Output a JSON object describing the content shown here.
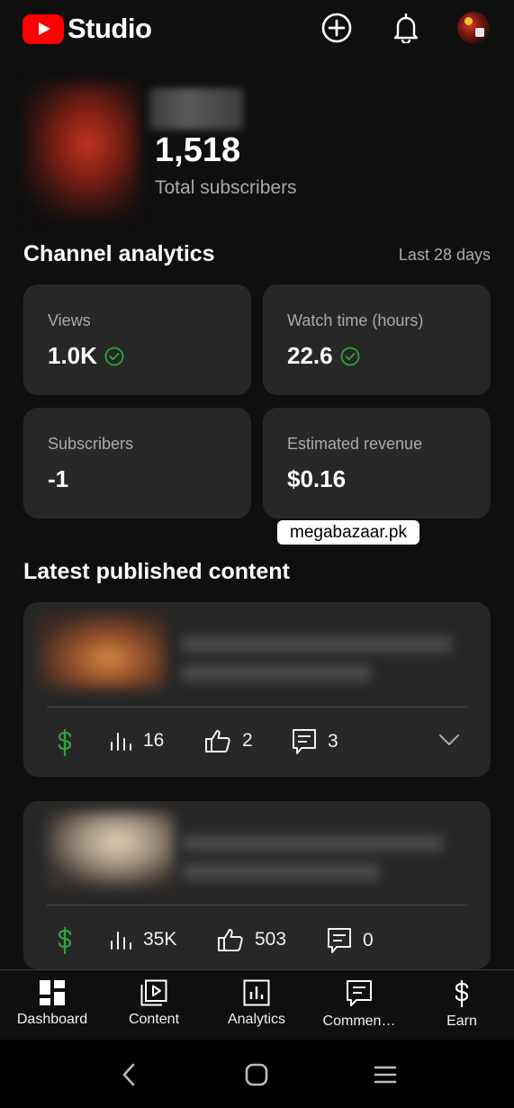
{
  "app": {
    "logo_text": "Studio",
    "logo_color": "#ff0000"
  },
  "header": {
    "icons": [
      "create-icon",
      "notifications-icon"
    ],
    "subscriber_count": "1,518",
    "subscriber_label": "Total subscribers"
  },
  "analytics": {
    "title": "Channel analytics",
    "range": "Last 28 days",
    "cards": [
      {
        "label": "Views",
        "value": "1.0K",
        "check": true
      },
      {
        "label": "Watch time (hours)",
        "value": "22.6",
        "check": true
      },
      {
        "label": "Subscribers",
        "value": "-1",
        "check": false
      },
      {
        "label": "Estimated revenue",
        "value": "$0.16",
        "check": false
      }
    ],
    "check_color": "#2ba640"
  },
  "watermark": "megabazaar.pk",
  "latest": {
    "title": "Latest published content",
    "videos": [
      {
        "views": "16",
        "likes": "2",
        "comments": "3"
      },
      {
        "views": "35K",
        "likes": "503",
        "comments": "0"
      }
    ],
    "monetized_color": "#2ba640"
  },
  "nav": {
    "items": [
      {
        "label": "Dashboard",
        "icon": "dashboard-icon"
      },
      {
        "label": "Content",
        "icon": "content-icon"
      },
      {
        "label": "Analytics",
        "icon": "analytics-icon"
      },
      {
        "label": "Commen…",
        "icon": "comments-icon"
      },
      {
        "label": "Earn",
        "icon": "earn-icon"
      }
    ]
  }
}
